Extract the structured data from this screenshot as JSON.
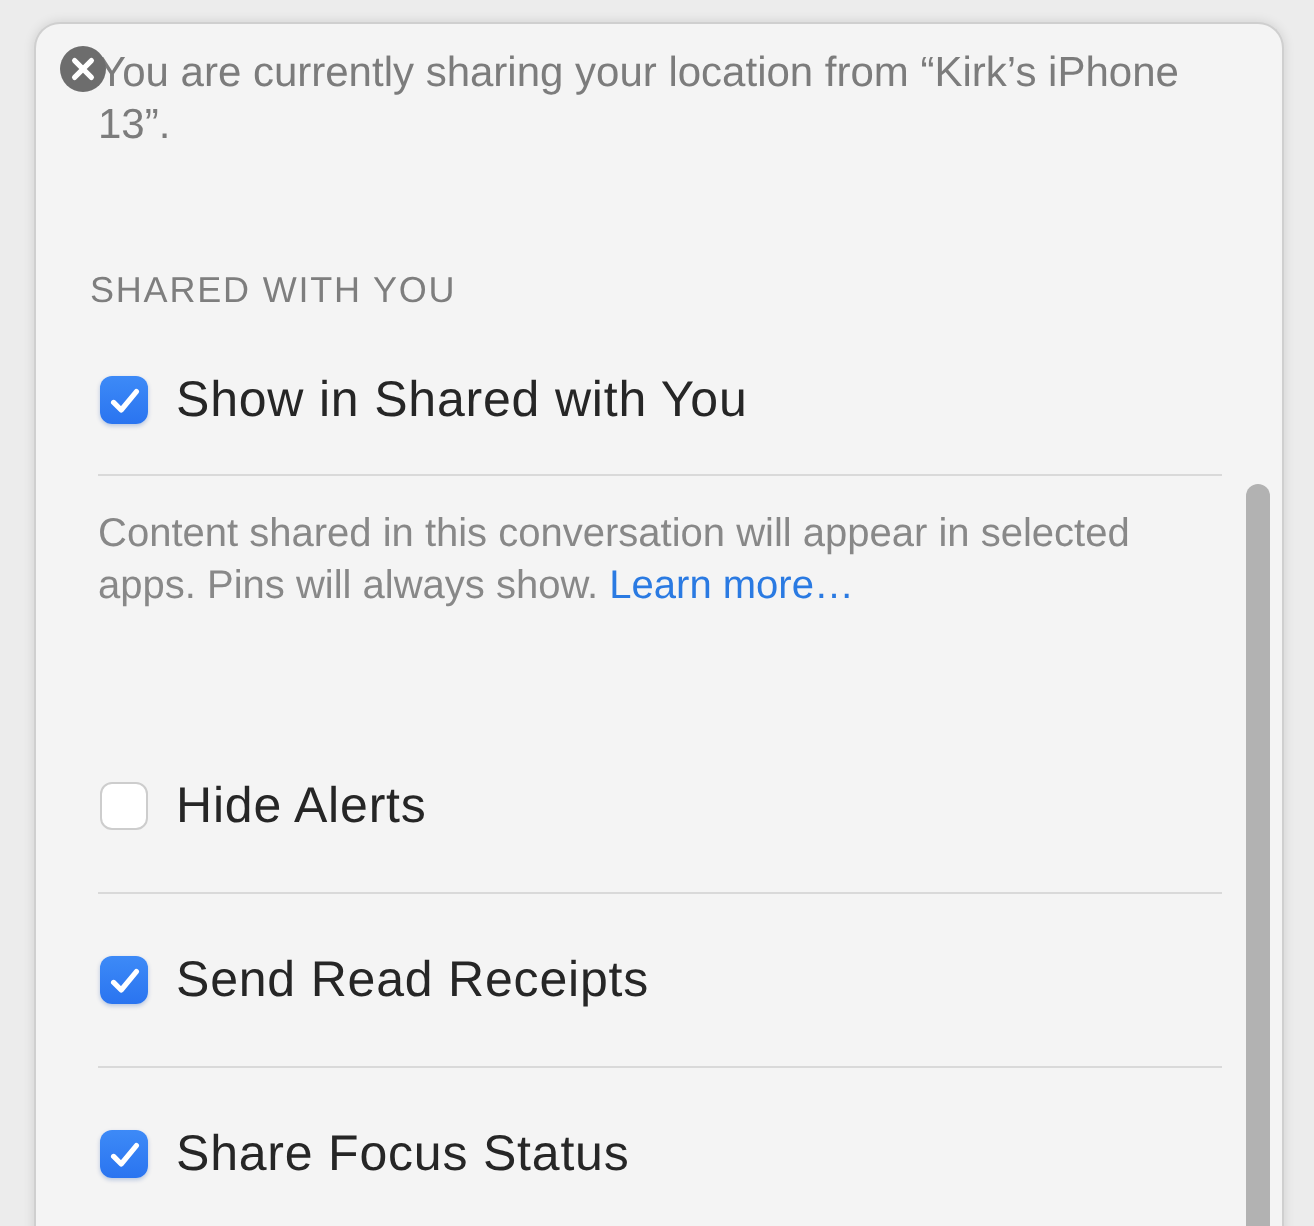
{
  "notice": "You are currently sharing your location from “Kirk’s iPhone 13”.",
  "shared_with_you": {
    "heading": "SHARED WITH YOU",
    "options": [
      {
        "label": "Show in Shared with You",
        "checked": true
      }
    ],
    "description": "Content shared in this conversation will appear in selected apps. Pins will always show.",
    "link": "Learn more…"
  },
  "options": [
    {
      "label": "Hide Alerts",
      "checked": false
    },
    {
      "label": "Send Read Receipts",
      "checked": true
    },
    {
      "label": "Share Focus Status",
      "checked": true
    }
  ]
}
